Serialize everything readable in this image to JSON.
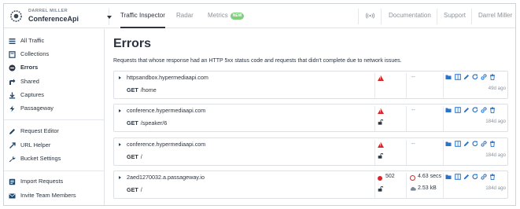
{
  "topbar": {
    "user_name": "DARREL MILLER",
    "workspace": "ConferenceApi",
    "tabs": [
      {
        "label": "Traffic Inspector"
      },
      {
        "label": "Radar"
      },
      {
        "label": "Metrics",
        "badge": "NEW"
      }
    ],
    "right": {
      "broadcast_icon": "broadcast-icon",
      "documentation": "Documentation",
      "support": "Support",
      "account": "Darrel Miller"
    }
  },
  "sidebar": {
    "items": [
      {
        "label": "All Traffic",
        "icon": "traffic-icon"
      },
      {
        "label": "Collections",
        "icon": "collections-icon"
      },
      {
        "label": "Errors",
        "icon": "errors-icon",
        "active": true
      },
      {
        "label": "Shared",
        "icon": "shared-icon"
      },
      {
        "label": "Captures",
        "icon": "captures-icon"
      },
      {
        "label": "Passageway",
        "icon": "passageway-icon"
      },
      {
        "label": "Request Editor",
        "icon": "editor-icon"
      },
      {
        "label": "URL Helper",
        "icon": "url-icon"
      },
      {
        "label": "Bucket Settings",
        "icon": "bucket-icon"
      },
      {
        "label": "Import Requests",
        "icon": "import-icon"
      },
      {
        "label": "Invite Team Members",
        "icon": "invite-icon"
      }
    ]
  },
  "main": {
    "title": "Errors",
    "description": "Requests that whose response had an HTTP 5xx status code and requests that didn't complete due to network issues.",
    "requests": [
      {
        "host": "httpsandbox.hypermediaapi.com",
        "method": "GET",
        "path": "/home",
        "status": "",
        "duration": "--",
        "size": "",
        "age": "49d ago"
      },
      {
        "host": "conference.hypermediaapi.com",
        "method": "GET",
        "path": "/speaker/6",
        "status": "",
        "duration": "--",
        "size": "",
        "age": "184d ago"
      },
      {
        "host": "conference.hypermediaapi.com",
        "method": "GET",
        "path": "/",
        "status": "",
        "duration": "--",
        "size": "",
        "age": "184d ago"
      },
      {
        "host": "2aed1270032.a.passageway.io",
        "method": "GET",
        "path": "/",
        "status": "502",
        "duration": "4.63 secs",
        "size": "2.53 kB",
        "age": "184d ago"
      }
    ]
  },
  "colors": {
    "accent_blue": "#2a73c9",
    "nav_icon": "#20456b",
    "error_red": "#d9262b",
    "new_badge": "#7ed07a"
  }
}
